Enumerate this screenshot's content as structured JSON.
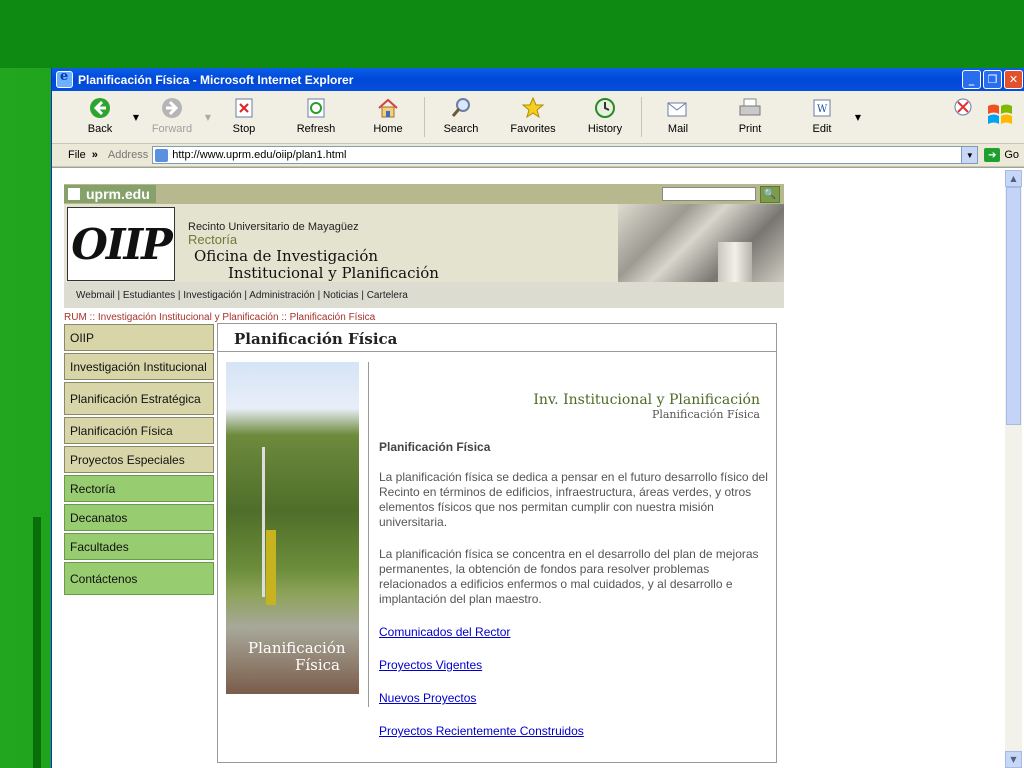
{
  "window": {
    "title": "Planificación Física - Microsoft Internet Explorer"
  },
  "toolbar": {
    "back": "Back",
    "forward": "Forward",
    "stop": "Stop",
    "refresh": "Refresh",
    "home": "Home",
    "search": "Search",
    "favorites": "Favorites",
    "history": "History",
    "mail": "Mail",
    "print": "Print",
    "edit": "Edit"
  },
  "menubar": {
    "file": "File",
    "address_label": "Address",
    "go": "Go"
  },
  "address": {
    "url": "http://www.uprm.edu/oiip/plan1.html"
  },
  "site": {
    "brand": "uprm.edu",
    "logo_text": "OIIP",
    "recinto": "Recinto Universitario de Mayagüez",
    "rectoria": "Rectoría",
    "oficina_1": "Oficina de Investigación",
    "oficina_2": "Institucional y Planificación",
    "topnav": "Webmail | Estudiantes | Investigación | Administración | Noticias | Cartelera",
    "breadcrumb": "RUM :: Investigación Institucional y Planificación :: Planificación Física"
  },
  "sidenav": [
    "OIIP",
    "Investigación Institucional",
    "Planificación Estratégica",
    "Planificación Física",
    "Proyectos Especiales",
    "Rectoría",
    "Decanatos",
    "Facultades",
    "Contáctenos"
  ],
  "content": {
    "title": "Planificación Física",
    "photo_caption_1": "Planificación",
    "photo_caption_2": "Física",
    "header_right_1": "Inv. Institucional y Planificación",
    "header_right_2": "Planificación Física",
    "section_heading": "Planificación Física",
    "para1": "La planificación física se dedica a pensar en el futuro desarrollo físico del Recinto en términos de edificios, infraestructura, áreas verdes, y otros elementos físicos que nos permitan cumplir con nuestra misión universitaria.",
    "para2": "La planificación física se concentra en el desarrollo del plan de mejoras permanentes, la obtención de fondos para resolver problemas relacionados a edificios enfermos o mal cuidados, y al desarrollo e implantación del plan maestro.",
    "links": [
      "Comunicados del Rector",
      "Proyectos Vigentes",
      "Nuevos Proyectos",
      "Proyectos Recientemente Construidos"
    ]
  }
}
